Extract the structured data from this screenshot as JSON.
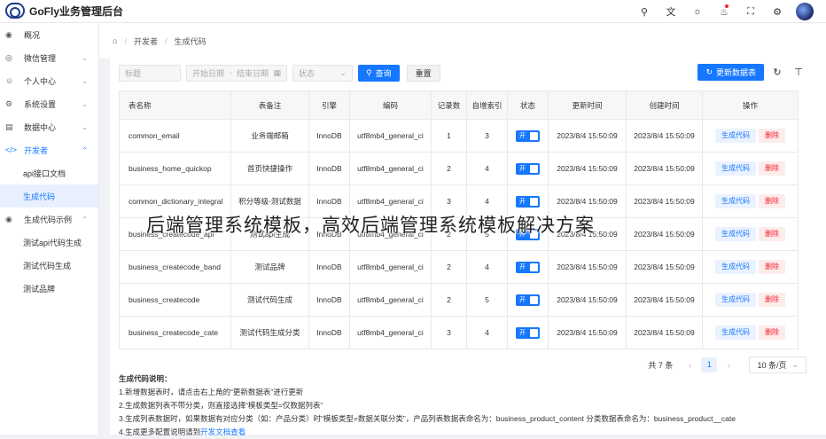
{
  "app": {
    "title": "GoFly业务管理后台"
  },
  "header": {
    "icons": [
      "search-icon",
      "translate-icon",
      "theme-icon",
      "bell-icon",
      "fullscreen-icon",
      "gear-icon"
    ]
  },
  "sidebar": {
    "items": [
      {
        "icon": "dashboard-icon",
        "label": "概况"
      },
      {
        "icon": "wechat-icon",
        "label": "微信管理"
      },
      {
        "icon": "user-icon",
        "label": "个人中心"
      },
      {
        "icon": "settings-icon",
        "label": "系统设置"
      },
      {
        "icon": "data-icon",
        "label": "数据中心"
      },
      {
        "icon": "code-icon",
        "label": "开发者"
      },
      {
        "icon": "example-icon",
        "label": "生成代码示例"
      }
    ],
    "dev_sub": [
      "api接口文档",
      "生成代码"
    ],
    "example_sub": [
      "测试api代码生成",
      "测试代码生成",
      "测试品牌"
    ]
  },
  "breadcrumb": {
    "home_icon": "home-icon",
    "items": [
      "开发者",
      "生成代码"
    ]
  },
  "toolbar": {
    "table_placeholder": "标题",
    "start_date": "开始日期",
    "dash": "-",
    "end_date": "结束日期",
    "status_placeholder": "状态",
    "query_label": "查询",
    "reset_label": "重置",
    "update_label": "更新数据表"
  },
  "table": {
    "headers": [
      "表名称",
      "表备注",
      "引擎",
      "编码",
      "记录数",
      "自增索引",
      "状态",
      "更新时间",
      "创建时间",
      "操作"
    ],
    "switch_label": "开",
    "gen_label": "生成代码",
    "del_label": "删除",
    "rows": [
      {
        "name": "common_email",
        "remark": "业务端邮箱",
        "engine": "InnoDB",
        "charset": "utf8mb4_general_ci",
        "records": "1",
        "auto_inc": "3",
        "updated": "2023/8/4 15:50:09",
        "created": "2023/8/4 15:50:09"
      },
      {
        "name": "business_home_quickop",
        "remark": "首页快捷操作",
        "engine": "InnoDB",
        "charset": "utf8mb4_general_ci",
        "records": "2",
        "auto_inc": "4",
        "updated": "2023/8/4 15:50:09",
        "created": "2023/8/4 15:50:09"
      },
      {
        "name": "common_dictionary_integral",
        "remark": "积分等级-测试数据",
        "engine": "InnoDB",
        "charset": "utf8mb4_general_ci",
        "records": "3",
        "auto_inc": "4",
        "updated": "2023/8/4 15:50:09",
        "created": "2023/8/4 15:50:09"
      },
      {
        "name": "business_createcode_api",
        "remark": "测试api生成",
        "engine": "InnoDB",
        "charset": "utf8mb4_general_ci",
        "records": "2",
        "auto_inc": "5",
        "updated": "2023/8/4 15:50:09",
        "created": "2023/8/4 15:50:09"
      },
      {
        "name": "business_createcode_band",
        "remark": "测试品牌",
        "engine": "InnoDB",
        "charset": "utf8mb4_general_ci",
        "records": "2",
        "auto_inc": "4",
        "updated": "2023/8/4 15:50:09",
        "created": "2023/8/4 15:50:09"
      },
      {
        "name": "business_createcode",
        "remark": "测试代码生成",
        "engine": "InnoDB",
        "charset": "utf8mb4_general_ci",
        "records": "2",
        "auto_inc": "5",
        "updated": "2023/8/4 15:50:09",
        "created": "2023/8/4 15:50:09"
      },
      {
        "name": "business_createcode_cate",
        "remark": "测试代码生成分类",
        "engine": "InnoDB",
        "charset": "utf8mb4_general_ci",
        "records": "3",
        "auto_inc": "4",
        "updated": "2023/8/4 15:50:09",
        "created": "2023/8/4 15:50:09"
      }
    ]
  },
  "pager": {
    "total": "共 7 条",
    "current": "1",
    "size": "10 条/页"
  },
  "notes": {
    "title": "生成代码说明：",
    "lines": [
      "1.新增数据表时，请点击右上角的“更新数据表”进行更新",
      "2.生成数据列表不带分类，则直接选择“模板类型=仅数据列表”",
      "3.生成列表数据时，如果数据有对应分类（如：产品分类）时“模板类型=数据关联分类”，产品列表数据表命名为：business_product_content 分类数据表命名为：business_product__cate"
    ],
    "line4_prefix": "4.生成更多配置说明请到",
    "line4_link": "开发文档查看"
  },
  "overlay": {
    "text": "后端管理系统模板，高效后端管理系统模板解决方案"
  }
}
